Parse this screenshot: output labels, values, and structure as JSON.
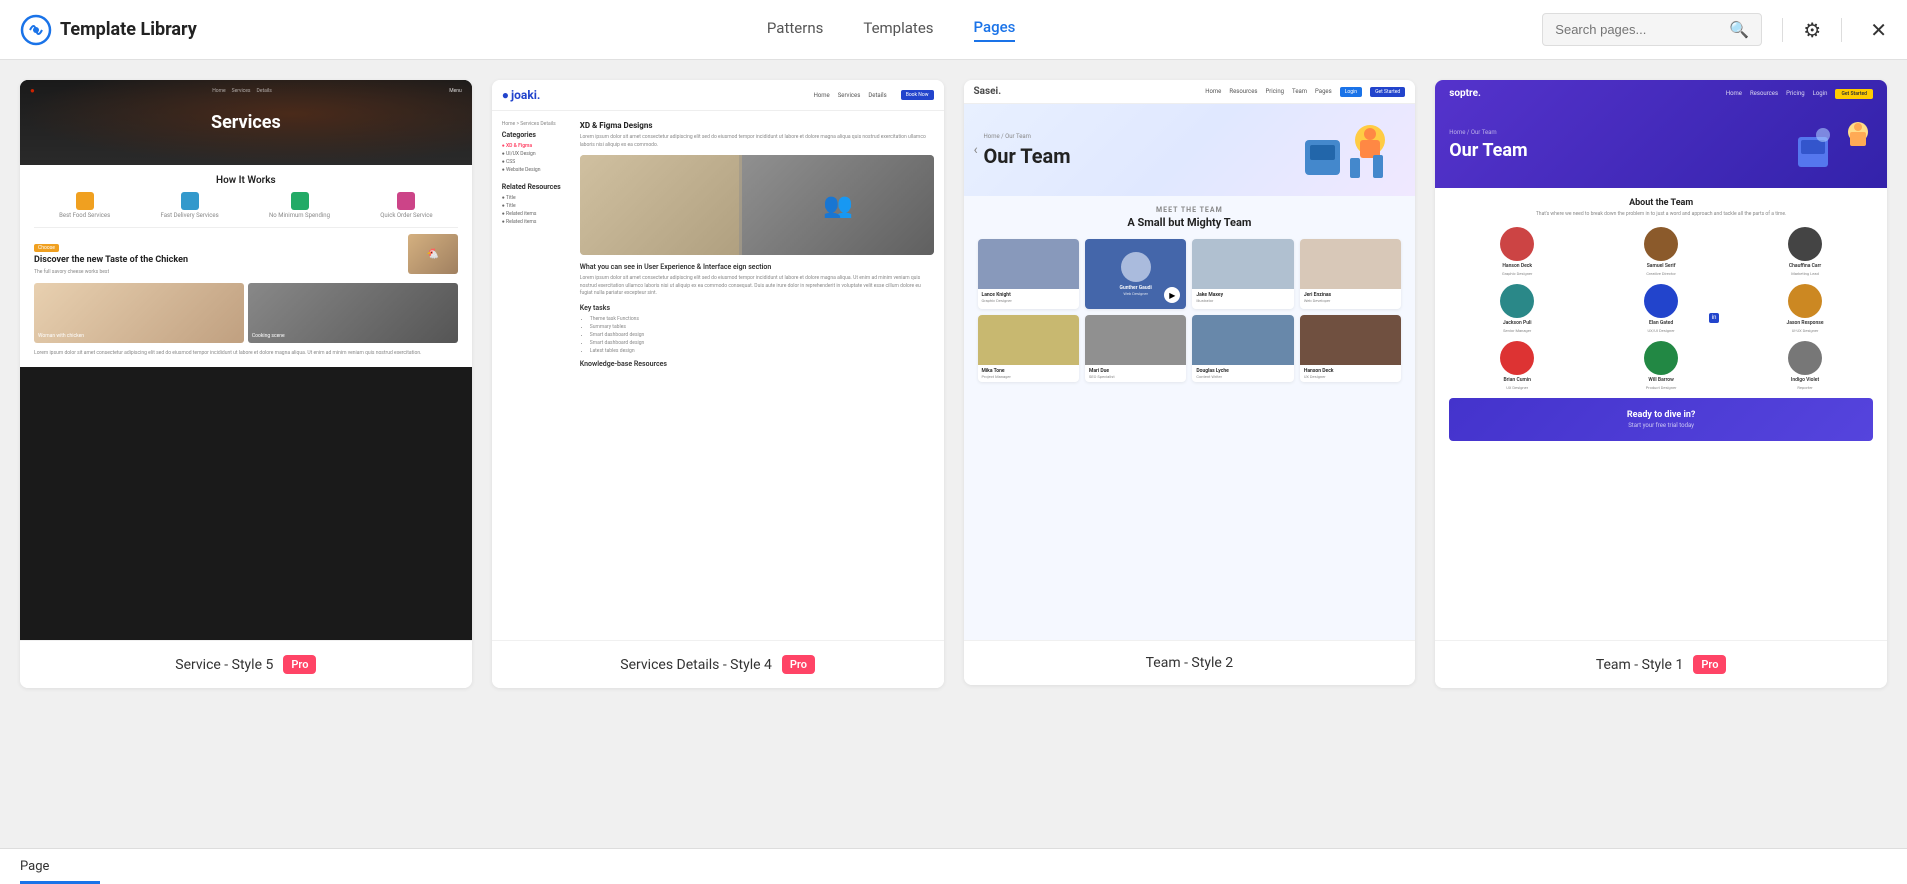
{
  "header": {
    "logo_text": "Template Library",
    "nav_tabs": [
      {
        "id": "patterns",
        "label": "Patterns",
        "active": false
      },
      {
        "id": "templates",
        "label": "Templates",
        "active": false
      },
      {
        "id": "pages",
        "label": "Pages",
        "active": true
      }
    ],
    "search_placeholder": "Search pages...",
    "filter_icon": "filter-icon",
    "close_icon": "close-icon"
  },
  "cards": [
    {
      "id": "card-1",
      "label": "Service - Style 5",
      "pro": true,
      "preview_type": "services",
      "preview_title": "Services",
      "section_title": "How It Works",
      "featured_chip": "Choose",
      "featured_title": "Discover the new Taste of the Chicken",
      "featured_sub": "The full savory cheese works best"
    },
    {
      "id": "card-2",
      "label": "Services Details - Style 4",
      "pro": true,
      "preview_type": "services-details",
      "preview_logo": "joaki.",
      "preview_heading": "XD & Figma Designs",
      "categories_label": "Categories",
      "related_label": "Related Resources",
      "section_title": "What you can see in User Experience & Interface eign section",
      "key_tasks_label": "Key tasks",
      "resources_label": "Knowledge-base Resources"
    },
    {
      "id": "card-3",
      "label": "Team - Style 2",
      "pro": false,
      "preview_type": "team-2",
      "preview_logo": "Sasei.",
      "hero_title": "Our Team",
      "hero_breadcrumb": "Home / Our Team",
      "section_label": "MEET THE TEAM",
      "section_title": "A Small but Mighty Team",
      "members": [
        {
          "name": "Lance Knight",
          "role": "Graphic Designer",
          "photo": "photo-1"
        },
        {
          "name": "Gunther Gaudi",
          "role": "Web Designer",
          "photo": "photo-2",
          "featured": true
        },
        {
          "name": "Jake Maxey",
          "role": "Illustrator",
          "photo": "photo-3"
        },
        {
          "name": "Jeri Enzinas",
          "role": "Web Developer",
          "photo": "photo-4"
        },
        {
          "name": "Mika Tone",
          "role": "Project Manager",
          "photo": "photo-5"
        },
        {
          "name": "Mari Due",
          "role": "SEO Specialist",
          "photo": "photo-6"
        },
        {
          "name": "Douglas Lyche",
          "role": "Content Writer",
          "photo": "photo-7"
        },
        {
          "name": "Hanson Deck",
          "role": "UX Designer",
          "photo": "photo-8"
        }
      ]
    },
    {
      "id": "card-4",
      "label": "Team - Style 1",
      "pro": true,
      "preview_type": "team-1",
      "preview_logo": "soptre.",
      "hero_title": "Our Team",
      "hero_breadcrumb": "Home / Our Team",
      "about_title": "About the Team",
      "about_text": "That's where we need to break down the problem in to just a word and approach and tackle all the parts of a time.",
      "members": [
        {
          "name": "Hanson Deck",
          "role": "Graphic Designer",
          "avatar": "avatar-red"
        },
        {
          "name": "Samuel Serif",
          "role": "Creative Director",
          "avatar": "avatar-brown"
        },
        {
          "name": "Chauffina Carr",
          "role": "Marketing Lead",
          "avatar": "avatar-dark"
        },
        {
          "name": "Jackson Puli",
          "role": "Senior Manager",
          "avatar": "avatar-teal"
        },
        {
          "name": "Elan Gated",
          "role": "UX/UI Designer",
          "avatar": "avatar-blue"
        },
        {
          "name": "Jason Response",
          "role": "UI-UX Designer",
          "avatar": "avatar-orange"
        },
        {
          "name": "Brian Cumin",
          "role": "UX Designer",
          "avatar": "avatar-red2"
        },
        {
          "name": "Will Barrow",
          "role": "Product Designer",
          "avatar": "avatar-green"
        },
        {
          "name": "Indigo Violet",
          "role": "Reporter",
          "avatar": "avatar-gray"
        }
      ],
      "cta_title": "Ready to dive in?",
      "cta_sub": "Start your free trial today"
    }
  ],
  "bottom_bar": {
    "label": "Page"
  }
}
